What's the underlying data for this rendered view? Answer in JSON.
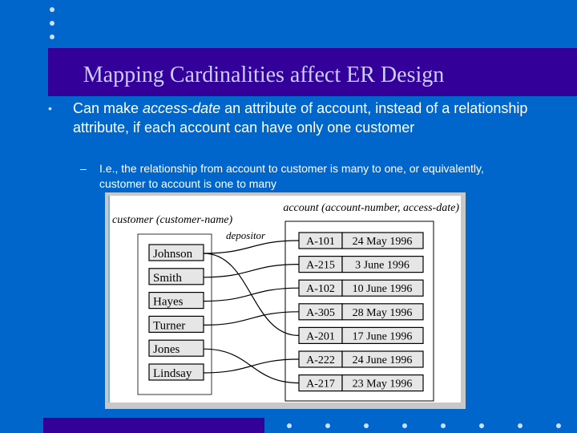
{
  "slide": {
    "title": "Mapping Cardinalities affect ER Design",
    "bullet_marker": "•",
    "bullet_text_before": "Can make ",
    "bullet_text_italic": "access-date",
    "bullet_text_after": " an attribute of account, instead of a relationship attribute, if each account can have only one customer",
    "sub_marker": "–",
    "sub_text": "I.e., the relationship from account to customer is many to one, or equivalently, customer to account is one to many"
  },
  "colors": {
    "background": "#0066CC",
    "title_band": "#330099",
    "title_text": "#CCCCFF",
    "dots": "#CCE0FF"
  },
  "figure": {
    "customer_label": "customer (customer-name)",
    "account_label": "account (account-number, access-date)",
    "relationship_label": "depositor",
    "customers": [
      "Johnson",
      "Smith",
      "Hayes",
      "Turner",
      "Jones",
      "Lindsay"
    ],
    "accounts": [
      {
        "number": "A-101",
        "date": "24 May 1996"
      },
      {
        "number": "A-215",
        "date": "3 June 1996"
      },
      {
        "number": "A-102",
        "date": "10 June 1996"
      },
      {
        "number": "A-305",
        "date": "28 May 1996"
      },
      {
        "number": "A-201",
        "date": "17 June 1996"
      },
      {
        "number": "A-222",
        "date": "24 June 1996"
      },
      {
        "number": "A-217",
        "date": "23 May 1996"
      }
    ],
    "links": [
      {
        "customer": "Johnson",
        "account": "A-101"
      },
      {
        "customer": "Johnson",
        "account": "A-201"
      },
      {
        "customer": "Smith",
        "account": "A-215"
      },
      {
        "customer": "Hayes",
        "account": "A-102"
      },
      {
        "customer": "Turner",
        "account": "A-305"
      },
      {
        "customer": "Jones",
        "account": "A-217"
      },
      {
        "customer": "Lindsay",
        "account": "A-222"
      }
    ]
  }
}
